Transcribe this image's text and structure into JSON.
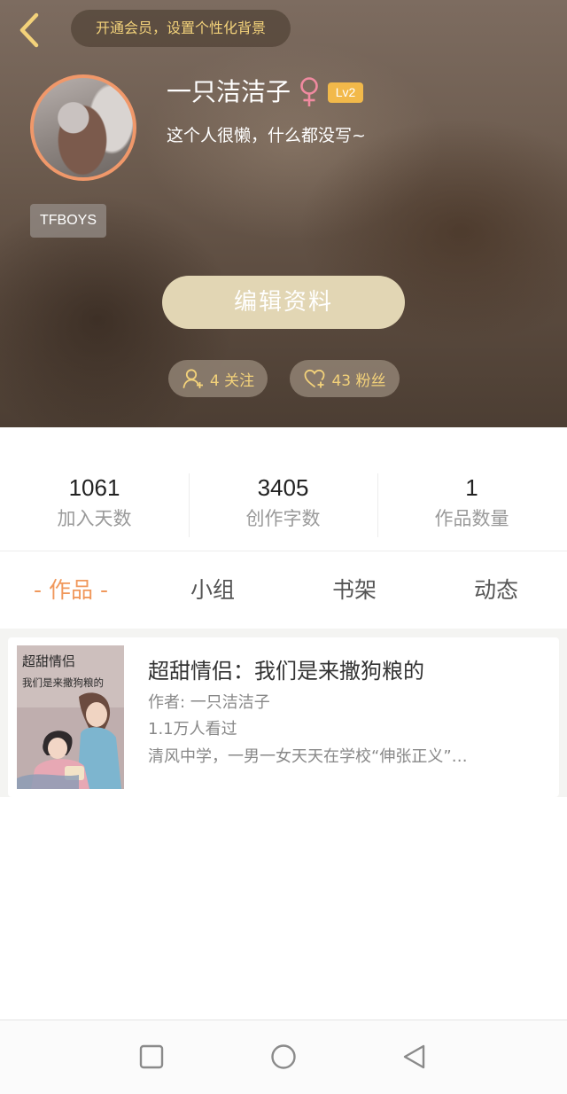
{
  "header": {
    "vip_banner": "开通会员，设置个性化背景",
    "username": "一只洁洁子",
    "gender_symbol": "♀",
    "level": "Lv2",
    "bio": "这个人很懒，什么都没写~",
    "tag": "TFBOYS",
    "edit_button": "编辑资料",
    "follow_label": "4 关注",
    "fans_label": "43 粉丝"
  },
  "stats": [
    {
      "value": "1061",
      "label": "加入天数"
    },
    {
      "value": "3405",
      "label": "创作字数"
    },
    {
      "value": "1",
      "label": "作品数量"
    }
  ],
  "tabs": [
    {
      "label": "- 作品 -",
      "active": true
    },
    {
      "label": "小组",
      "active": false
    },
    {
      "label": "书架",
      "active": false
    },
    {
      "label": "动态",
      "active": false
    }
  ],
  "works": [
    {
      "cover_title": "超甜情侣",
      "cover_subtitle": "我们是来撒狗粮的",
      "title": "超甜情侣：我们是来撒狗粮的",
      "author": "作者: 一只洁洁子",
      "views": "1.1万人看过",
      "description": "清风中学，一男一女天天在学校“伸张正义”…"
    }
  ],
  "colors": {
    "accent_orange": "#f0985c",
    "gold_text": "#f3d27a",
    "level_badge": "#f2b94a",
    "edit_button": "#e2d6b4"
  },
  "icons": {
    "back": "chevron-left-icon",
    "gender": "female-icon",
    "follow": "add-user-icon",
    "fans": "heart-icon",
    "nav_recent": "square-icon",
    "nav_home": "circle-icon",
    "nav_back": "triangle-back-icon"
  }
}
